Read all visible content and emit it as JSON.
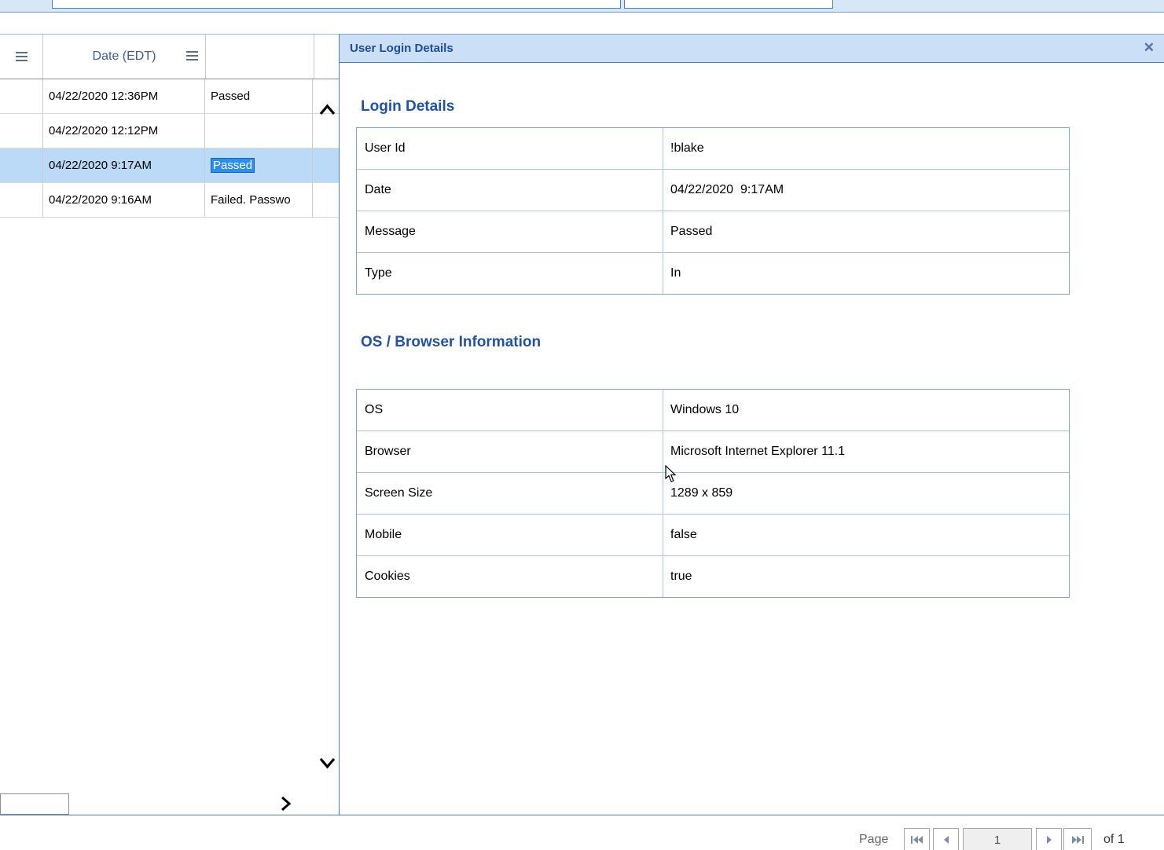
{
  "top_bar": {
    "filter_1_value": "",
    "filter_2_value": ""
  },
  "grid": {
    "columns": {
      "date_header": "Date (EDT)"
    },
    "rows": [
      {
        "date": "04/22/2020 12:36PM",
        "status": "Passed"
      },
      {
        "date": "04/22/2020 12:12PM",
        "status": ""
      },
      {
        "date": "04/22/2020 9:17AM",
        "status": "Passed"
      },
      {
        "date": "04/22/2020 9:16AM",
        "status": "Failed. Passwo"
      }
    ]
  },
  "detail_panel": {
    "title": "User Login Details",
    "close_glyph": "✕",
    "sections": [
      {
        "heading": "Login Details",
        "rows": [
          {
            "label": "User Id",
            "value": "!blake"
          },
          {
            "label": "Date",
            "value": "04/22/2020  9:17AM"
          },
          {
            "label": "Message",
            "value": "Passed"
          },
          {
            "label": "Type",
            "value": "In"
          }
        ]
      },
      {
        "heading": "OS / Browser Information",
        "rows": [
          {
            "label": "OS",
            "value": "Windows 10"
          },
          {
            "label": "Browser",
            "value": "Microsoft Internet Explorer 11.1"
          },
          {
            "label": "Screen Size",
            "value": "1289 x 859"
          },
          {
            "label": "Mobile",
            "value": "false"
          },
          {
            "label": "Cookies",
            "value": "true"
          }
        ]
      }
    ]
  },
  "pagination": {
    "label": "Page",
    "current": "1",
    "suffix": "of 1"
  },
  "colors": {
    "accent_blue": "#1e4c9c",
    "panel_header_bg": "#cbdff7",
    "selected_row_bg": "#bbdaf8",
    "selection_highlight": "#2d8ef0",
    "table_border": "#7fa3d4"
  }
}
